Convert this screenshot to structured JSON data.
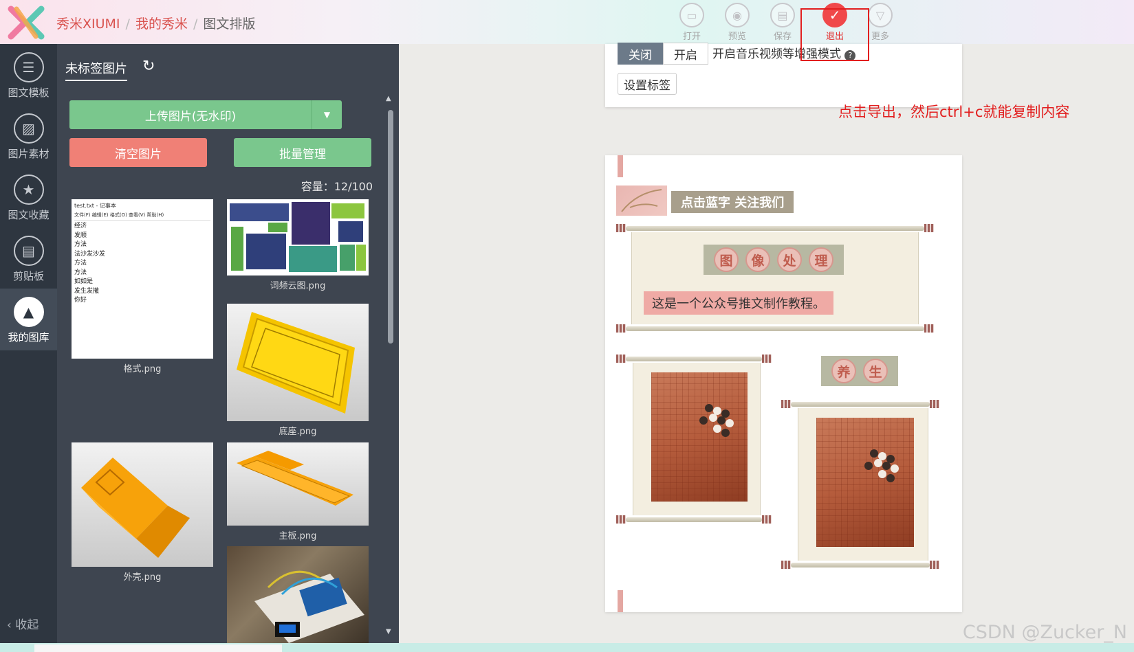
{
  "header": {
    "breadcrumb": [
      "秀米XIUMI",
      "我的秀米",
      "图文排版"
    ],
    "separator": "/",
    "tools": [
      {
        "label": "打开",
        "icon": "folder-icon"
      },
      {
        "label": "预览",
        "icon": "preview-icon"
      },
      {
        "label": "保存",
        "icon": "save-icon"
      },
      {
        "label": "退出",
        "icon": "check-icon"
      },
      {
        "label": "更多",
        "icon": "chevron-down-icon"
      }
    ]
  },
  "leftnav": {
    "items": [
      {
        "label": "图文模板",
        "icon": "list-icon"
      },
      {
        "label": "图片素材",
        "icon": "image-icon"
      },
      {
        "label": "图文收藏",
        "icon": "star-list-icon"
      },
      {
        "label": "剪贴板",
        "icon": "clipboard-icon"
      },
      {
        "label": "我的图库",
        "icon": "gallery-icon"
      }
    ],
    "collapse": "收起"
  },
  "panel": {
    "tab": "未标签图片",
    "upload": "上传图片(无水印)",
    "clear": "清空图片",
    "batch": "批量管理",
    "capacity": "容量：12/100",
    "notepad_title": "test.txt - 记事本",
    "notepad_menu": "文件(F)  编辑(E)  格式(O)  查看(V)  帮助(H)",
    "notepad_lines": [
      "经济",
      "发顺",
      "方法",
      "法沙发沙发",
      "方法",
      "方法",
      "如如是",
      "发生发撒",
      "你好"
    ],
    "images": [
      {
        "caption": "格式.png"
      },
      {
        "caption": "词频云图.png"
      },
      {
        "caption": "底座.png"
      },
      {
        "caption": "外壳.png"
      },
      {
        "caption": "主板.png"
      },
      {
        "caption": ""
      }
    ]
  },
  "editor": {
    "btn_close": "关闭",
    "btn_open": "开启",
    "music_mode": "开启音乐视频等增强模式",
    "set_tag": "设置标签",
    "annotation": "点击导出，然后ctrl+c就能复制内容"
  },
  "article": {
    "follow": "点击蓝字 关注我们",
    "title_chars": [
      "图",
      "像",
      "处",
      "理"
    ],
    "intro": "这是一个公众号推文制作教程。",
    "sub_chars": [
      "养",
      "生"
    ]
  },
  "watermark": "CSDN @Zucker_N",
  "colors": {
    "accent_red": "#e21f1f",
    "green": "#7ac78d",
    "coral": "#f08076",
    "nav_bg": "#2e3640"
  }
}
